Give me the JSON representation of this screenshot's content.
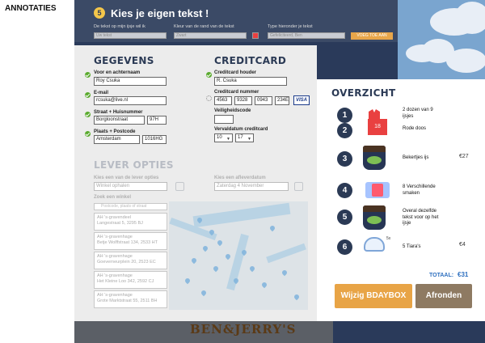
{
  "annotation_label": "ANNOTATIES",
  "header": {
    "step": "5",
    "title": "Kies je eigen tekst !",
    "labels": [
      "De tekst op mijn ijsje wil ik",
      "Kleur van de rand van de tekst",
      "Type hieronder je tekst"
    ],
    "inputs": [
      "Uw tekst",
      "Zwart",
      "Gefeliciteerd, Ben"
    ],
    "button": "VOEG TOE AAN"
  },
  "gegevens": {
    "title": "GEGEVENS",
    "name_label": "Voor en achternaam",
    "name_value": "Roy Csuka",
    "email_label": "E-mail",
    "email_value": "rcsuka@live.nl",
    "street_label": "Straat + Huisnummer",
    "street_value": "Borgloonstraat",
    "housenr_value": "97H",
    "city_label": "Plaats + Postcode",
    "city_value": "Amsterdam",
    "postcode_value": "1016HG"
  },
  "creditcard": {
    "title": "CREDITCARD",
    "holder_label": "Creditcard houder",
    "holder_value": "R. Csuka",
    "number_label": "Creditcard nummer",
    "number_parts": [
      "4563",
      "9328",
      "0943",
      "234E"
    ],
    "brand": "VISA",
    "cvc_label": "Veiligheidscode",
    "cvc_value": "",
    "expiry_label": "Vervaldatum creditcard",
    "expiry_month": "10",
    "expiry_year": "17"
  },
  "lever": {
    "title": "LEVER OPTIES",
    "option_label": "Kies een van de lever opties",
    "option_value": "Winkel ophalen",
    "date_label": "Kies een afleverdatum",
    "date_value": "Zaterdag 4 November",
    "store_label": "Zoek een winkel",
    "search_placeholder": "Postcode, plaats of straat",
    "stores": [
      {
        "name": "AH 's-gravendeel",
        "address": "Langestraat 5, 3295 BJ"
      },
      {
        "name": "AH 's-gravenhage",
        "address": "Betje Wolffstraat 134, 2533 HT"
      },
      {
        "name": "AH 's-gravenhage",
        "address": "Goeverneurplein 20, 2523 EC"
      },
      {
        "name": "AH 's-gravenhage",
        "address": "Het Kleine Loo 342, 2592 CJ"
      },
      {
        "name": "AH 's-gravenhage",
        "address": "Grote Marktstraat 55, 2511 BH"
      }
    ]
  },
  "overzicht": {
    "title": "OVERZICHT",
    "box_number": "18",
    "items": [
      {
        "num": "1",
        "text": "2 dozen van 9 ijsjes",
        "price": ""
      },
      {
        "num": "2",
        "text": "Rode doos",
        "price": ""
      },
      {
        "num": "3",
        "text": "Bekertjes ijs",
        "price": "€27"
      },
      {
        "num": "4",
        "text": "8 Verschillende smaken",
        "price": ""
      },
      {
        "num": "5",
        "text": "Overal dezelfde tekst voor op het ijsje",
        "price": ""
      },
      {
        "num": "6",
        "text": "5 Tiara's",
        "price": "€4"
      }
    ],
    "tiara_count": "5x",
    "total_label": "TOTAAL:",
    "total_value": "€31",
    "btn_change": "Wijzig BDAYBOX",
    "btn_finish": "Afronden"
  },
  "brand_logo": "BEN&JERRY'S"
}
